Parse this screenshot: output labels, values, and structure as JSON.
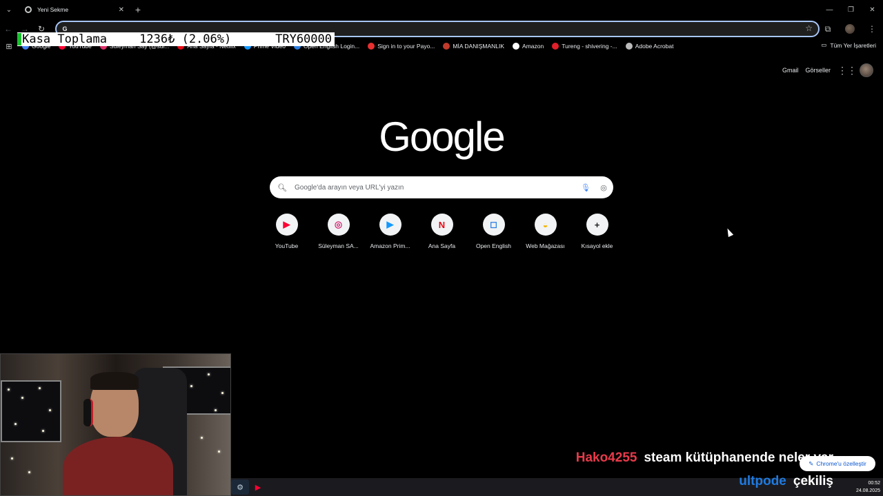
{
  "tab": {
    "title": "Yeni Sekme"
  },
  "omnibox": {
    "value": ""
  },
  "overlay": {
    "title": "Kasa Toplama",
    "amount": "1236₺ (2.06%)",
    "goal": "TRY60000",
    "progress_percent": 2.06
  },
  "bookmarks": {
    "items": [
      {
        "label": "Google",
        "color": "#4285f4"
      },
      {
        "label": "YouTube",
        "color": "#ff0033"
      },
      {
        "label": "Süleyman Say (@sul...",
        "color": "#e1306c"
      },
      {
        "label": "Ana Sayfa - Netflix",
        "color": "#e50914"
      },
      {
        "label": "Prime Video",
        "color": "#1399ff"
      },
      {
        "label": "Open English Login...",
        "color": "#2a7de1"
      },
      {
        "label": "Sign in to your Payo...",
        "color": "#e83030"
      },
      {
        "label": "MİA DANIŞMANLIK",
        "color": "#c0392b"
      },
      {
        "label": "Amazon",
        "color": "#ffffff"
      },
      {
        "label": "Tureng - shivering -...",
        "color": "#e0202a"
      },
      {
        "label": "Adobe Acrobat",
        "color": "#bbbbbb"
      }
    ],
    "all_label": "Tüm Yer İşaretleri"
  },
  "google": {
    "gmail": "Gmail",
    "images": "Görseller",
    "logo": "Google"
  },
  "search": {
    "placeholder": "Google'da arayın veya URL'yi yazın"
  },
  "shortcuts": [
    {
      "label": "YouTube",
      "glyph": "▶",
      "color": "#ff0033"
    },
    {
      "label": "Süleyman SA...",
      "glyph": "◎",
      "color": "#d62976"
    },
    {
      "label": "Amazon Prim...",
      "glyph": "▶",
      "color": "#1399ff"
    },
    {
      "label": "Ana Sayfa",
      "glyph": "N",
      "color": "#e50914"
    },
    {
      "label": "Open English",
      "glyph": "◻",
      "color": "#2a7de1"
    },
    {
      "label": "Web Mağazası",
      "glyph": "◒",
      "color": "#f4b400"
    },
    {
      "label": "Kısayol ekle",
      "glyph": "+",
      "color": "#202124"
    }
  ],
  "chat": [
    {
      "user": "Hako4255",
      "message": "steam kütüphanende neler var"
    },
    {
      "user": "ultpode",
      "message": "çekiliş"
    }
  ],
  "customize": {
    "label": "Chrome'u özelleştir"
  },
  "clock": {
    "time": "00:52",
    "date": "24.08.2025"
  }
}
